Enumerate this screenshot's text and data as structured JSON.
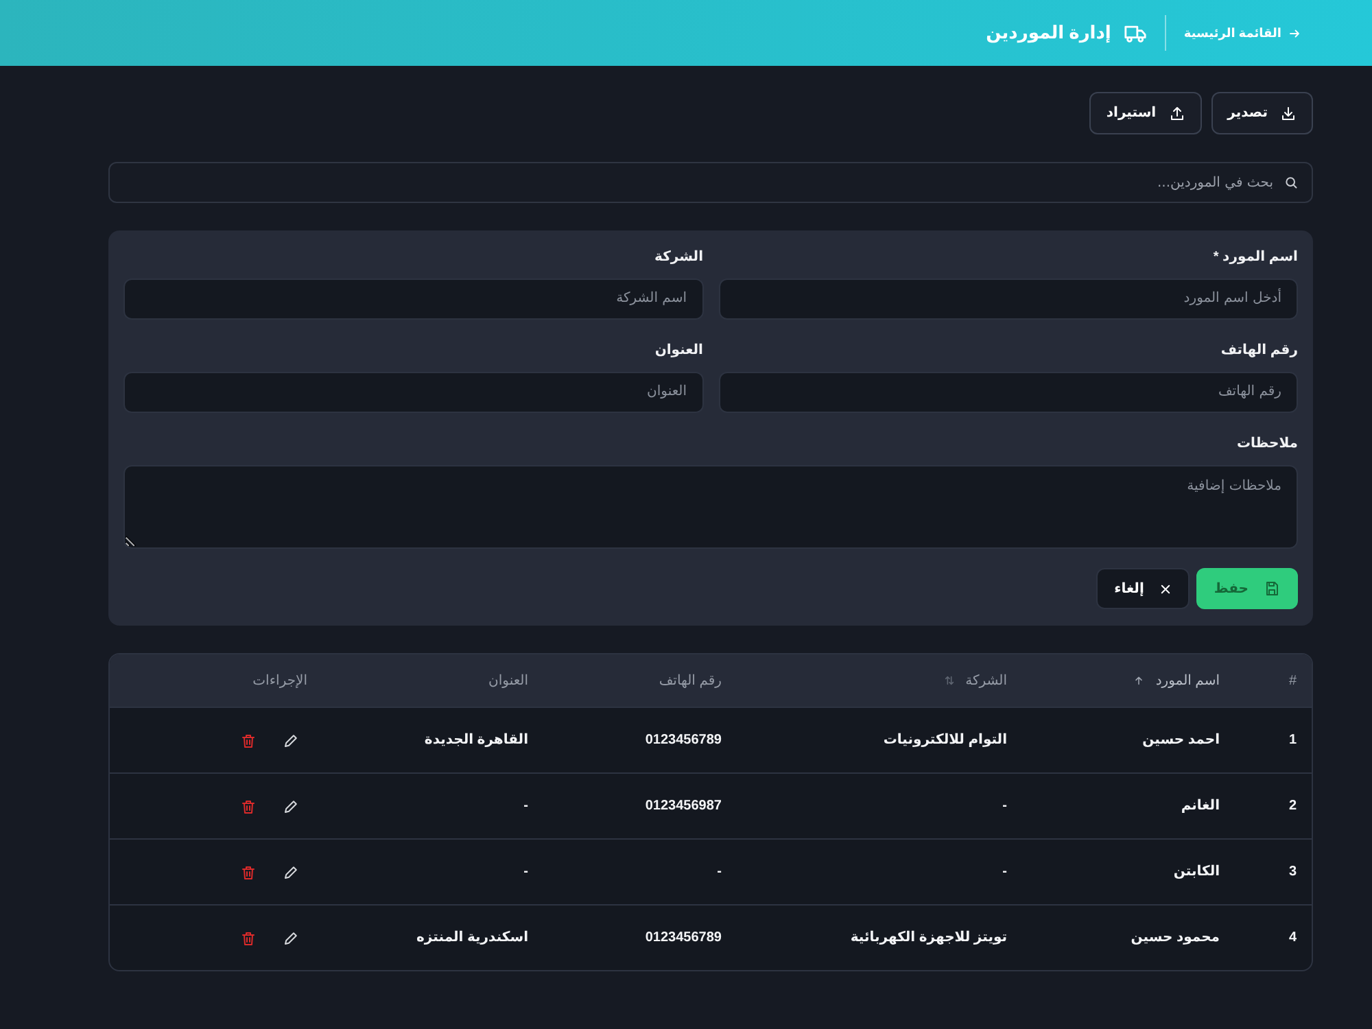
{
  "header": {
    "back_link": "القائمة الرئيسية",
    "title": "إدارة الموردين"
  },
  "toolbar": {
    "buttons": [
      {
        "label": "تصدير",
        "kind": "export"
      },
      {
        "label": "استيراد",
        "kind": "import"
      }
    ]
  },
  "search": {
    "placeholder": "بحث في الموردين..."
  },
  "form": {
    "fields": [
      {
        "label": "اسم المورد *",
        "placeholder": "أدخل اسم المورد",
        "kind": "text"
      },
      {
        "label": "الشركة",
        "placeholder": "اسم الشركة",
        "kind": "text"
      },
      {
        "label": "رقم الهاتف",
        "placeholder": "رقم الهاتف",
        "kind": "text"
      },
      {
        "label": "العنوان",
        "placeholder": "العنوان",
        "kind": "text"
      },
      {
        "label": "ملاحظات",
        "placeholder": "ملاحظات إضافية",
        "kind": "textarea"
      }
    ],
    "buttons": [
      {
        "label": "حفظ",
        "kind": "save"
      },
      {
        "label": "إلغاء",
        "kind": "cancel"
      }
    ]
  },
  "table": {
    "columns": [
      {
        "label": "#",
        "kind": "text",
        "sortable": false,
        "sorted": false
      },
      {
        "label": "اسم المورد",
        "kind": "text",
        "sortable": true,
        "sorted": true
      },
      {
        "label": "الشركة",
        "kind": "text",
        "sortable": true,
        "sorted": false
      },
      {
        "label": "رقم الهاتف",
        "kind": "text",
        "sortable": false,
        "sorted": false
      },
      {
        "label": "العنوان",
        "kind": "text",
        "sortable": false,
        "sorted": false
      },
      {
        "label": "الإجراءات",
        "kind": "actions",
        "sortable": false,
        "sorted": false
      }
    ],
    "rows": [
      {
        "cells": [
          "1",
          "احمد حسين",
          "التوام للالكترونيات",
          "0123456789",
          "القاهرة الجديدة"
        ]
      },
      {
        "cells": [
          "2",
          "الغانم",
          "-",
          "0123456987",
          "-"
        ]
      },
      {
        "cells": [
          "3",
          "الكابتن",
          "-",
          "-",
          "-"
        ]
      },
      {
        "cells": [
          "4",
          "محمود حسين",
          "تويتز للاجهزة الكهربائية",
          "0123456789",
          "اسكندرية المنتزه"
        ]
      }
    ]
  }
}
